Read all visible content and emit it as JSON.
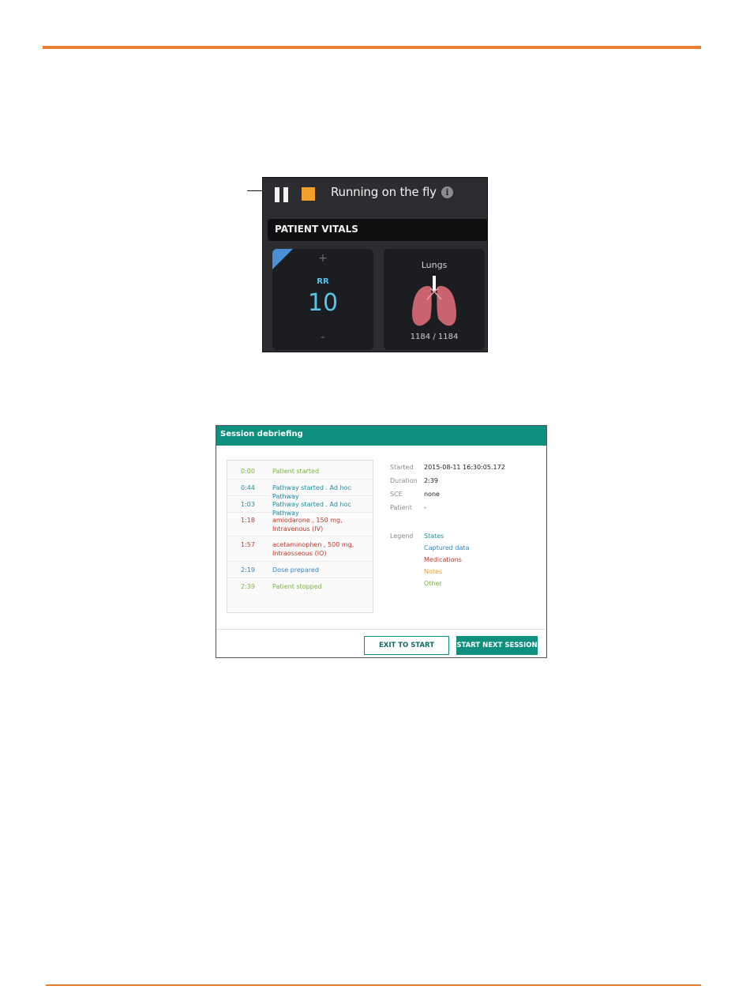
{
  "colors": {
    "accent_rule": "#e87e2f",
    "panel_bg": "#2b2d30",
    "rr_blue": "#58c3ea",
    "stop_orange": "#f2a02b",
    "teal": "#0f8f7e",
    "lung_pink": "#c9646e",
    "state_color": "#1c8fa0",
    "captured_color": "#2f87c5",
    "medication_color": "#c0392b",
    "note_color": "#e4a32a",
    "other_color": "#7cb342"
  },
  "run_panel": {
    "title": "Running on the fly",
    "pause_icon": "pause-icon",
    "stop_icon": "stop-icon",
    "info_icon": "info-icon",
    "vitals_title": "PATIENT VITALS",
    "rr": {
      "label": "RR",
      "value": "10",
      "plus": "+",
      "minus": "-"
    },
    "lungs": {
      "label": "Lungs",
      "count": "1184 / 1184",
      "icon": "lungs-icon"
    }
  },
  "debrief": {
    "title": "Session debriefing",
    "events": [
      {
        "time": "0:00",
        "desc": "Patient started",
        "kind": "other"
      },
      {
        "time": "0:44",
        "desc": "Pathway started . Ad hoc Pathway",
        "kind": "state"
      },
      {
        "time": "1:03",
        "desc": "Pathway started . Ad hoc Pathway",
        "kind": "state"
      },
      {
        "time": "1:18",
        "desc": "amiodarone , 150 mg, Intravenous (IV)",
        "kind": "medication"
      },
      {
        "time": "1:57",
        "desc": "acetaminophen , 500 mg, Intraosseous (IO)",
        "kind": "medication"
      },
      {
        "time": "2:19",
        "desc": "Dose prepared",
        "kind": "captured"
      },
      {
        "time": "2:39",
        "desc": "Patient stopped",
        "kind": "other"
      }
    ],
    "meta": {
      "started_label": "Started",
      "started_value": "2015-08-11 16:30:05.172",
      "duration_label": "Duration",
      "duration_value": "2:39",
      "sce_label": "SCE",
      "sce_value": "none",
      "patient_label": "Patient",
      "patient_value": "-"
    },
    "legend": {
      "label": "Legend",
      "items": [
        "States",
        "Captured data",
        "Medications",
        "Notes",
        "Other"
      ]
    },
    "buttons": {
      "exit": "EXIT TO START SCREEN",
      "next": "START NEXT SESSION"
    }
  }
}
